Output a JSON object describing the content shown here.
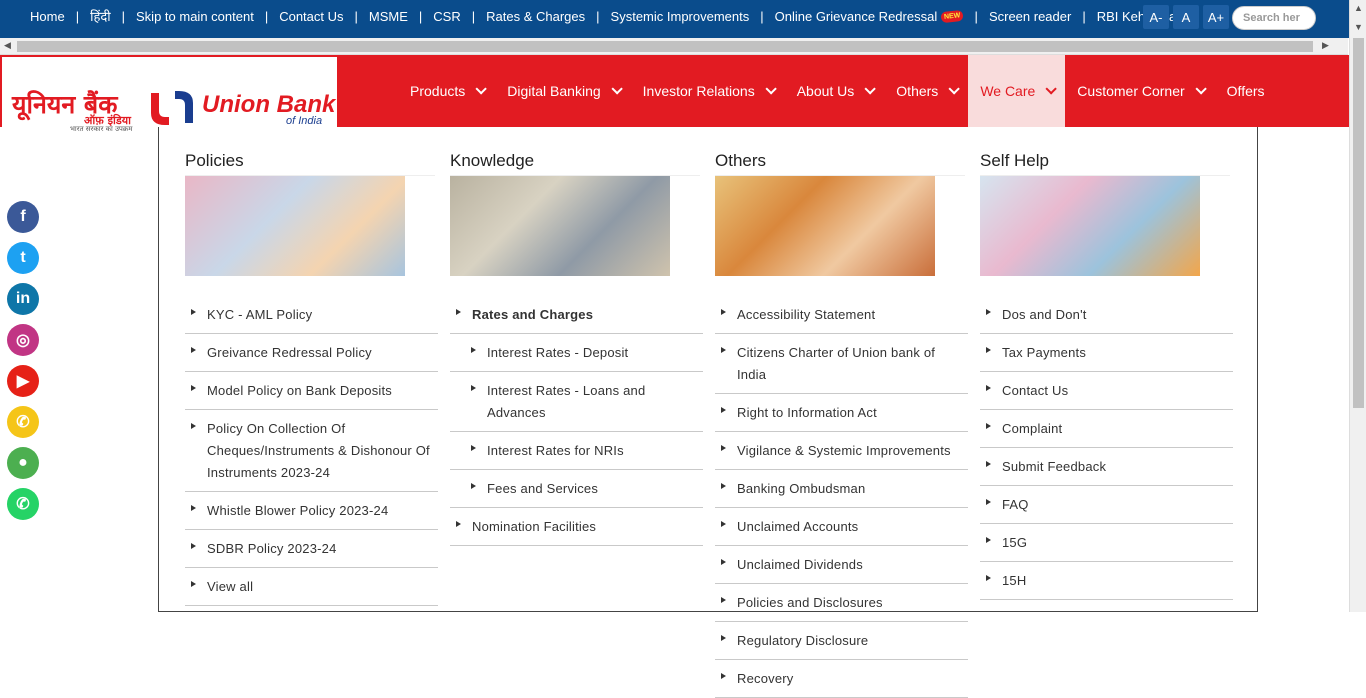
{
  "topbar": {
    "links": [
      "Home",
      "हिंदी",
      "Skip to main content",
      "Contact Us",
      "MSME",
      "CSR",
      "Rates & Charges",
      "Systemic Improvements",
      "Online Grievance Redressal",
      "Screen reader",
      "RBI Kehta Hai"
    ],
    "new_badge": "NEW",
    "font_buttons": [
      "A-",
      "A",
      "A+"
    ],
    "search_placeholder": "Search her"
  },
  "logo": {
    "hindi": "यूनियन बैंक",
    "hindi_sub": "ऑफ़ इंडिया",
    "tagline": "भारत सरकार का उपक्रम",
    "english": "Union Bank",
    "english_sub": "of India"
  },
  "nav": {
    "items": [
      {
        "label": "Products",
        "chevron": true
      },
      {
        "label": "Digital Banking",
        "chevron": true
      },
      {
        "label": "Investor Relations",
        "chevron": true
      },
      {
        "label": "About Us",
        "chevron": true
      },
      {
        "label": "Others",
        "chevron": true
      },
      {
        "label": "We Care",
        "chevron": true,
        "active": true
      },
      {
        "label": "Customer Corner",
        "chevron": true
      },
      {
        "label": "Offers",
        "chevron": false
      }
    ]
  },
  "social": [
    {
      "icon": "facebook-icon",
      "glyph": "f",
      "color": "#3b5998"
    },
    {
      "icon": "twitter-icon",
      "glyph": "t",
      "color": "#1da1f2"
    },
    {
      "icon": "linkedin-icon",
      "glyph": "in",
      "color": "#0e76a8"
    },
    {
      "icon": "instagram-icon",
      "glyph": "◎",
      "color": "#c13584"
    },
    {
      "icon": "youtube-icon",
      "glyph": "▶",
      "color": "#e62117"
    },
    {
      "icon": "phone-icon",
      "glyph": "✆",
      "color": "#f5c518"
    },
    {
      "icon": "map-pin-icon",
      "glyph": "●",
      "color": "#4caf50"
    },
    {
      "icon": "whatsapp-icon",
      "glyph": "✆",
      "color": "#25d366"
    }
  ],
  "mega_menu": {
    "columns": [
      {
        "title": "Policies",
        "items": [
          {
            "label": "KYC - AML Policy"
          },
          {
            "label": "Greivance Redressal Policy"
          },
          {
            "label": "Model Policy on Bank Deposits"
          },
          {
            "label": "Policy On Collection Of Cheques/Instruments & Dishonour Of Instruments 2023-24"
          },
          {
            "label": "Whistle Blower Policy 2023-24"
          },
          {
            "label": "SDBR Policy 2023-24"
          },
          {
            "label": "View all"
          }
        ]
      },
      {
        "title": "Knowledge",
        "items": [
          {
            "label": "Rates and Charges",
            "bold": true
          },
          {
            "label": "Interest Rates - Deposit",
            "sub": true
          },
          {
            "label": "Interest Rates - Loans and Advances",
            "sub": true
          },
          {
            "label": "Interest Rates for NRIs",
            "sub": true
          },
          {
            "label": "Fees and Services",
            "sub": true
          },
          {
            "label": "Nomination Facilities"
          }
        ]
      },
      {
        "title": "Others",
        "items": [
          {
            "label": "Accessibility Statement"
          },
          {
            "label": "Citizens Charter of Union bank of India"
          },
          {
            "label": "Right to Information Act"
          },
          {
            "label": "Vigilance & Systemic Improvements"
          },
          {
            "label": "Banking Ombudsman"
          },
          {
            "label": "Unclaimed Accounts"
          },
          {
            "label": "Unclaimed Dividends"
          },
          {
            "label": "Policies and Disclosures"
          },
          {
            "label": "Regulatory Disclosure"
          },
          {
            "label": "Recovery"
          }
        ]
      },
      {
        "title": "Self Help",
        "items": [
          {
            "label": "Dos and Don't"
          },
          {
            "label": "Tax Payments"
          },
          {
            "label": "Contact Us"
          },
          {
            "label": "Complaint"
          },
          {
            "label": "Submit Feedback"
          },
          {
            "label": "FAQ"
          },
          {
            "label": "15G"
          },
          {
            "label": "15H"
          }
        ]
      }
    ]
  },
  "colors": {
    "topbar": "#0a4c8c",
    "header": "#e21b22",
    "active_nav_bg": "#f9dcdc"
  }
}
